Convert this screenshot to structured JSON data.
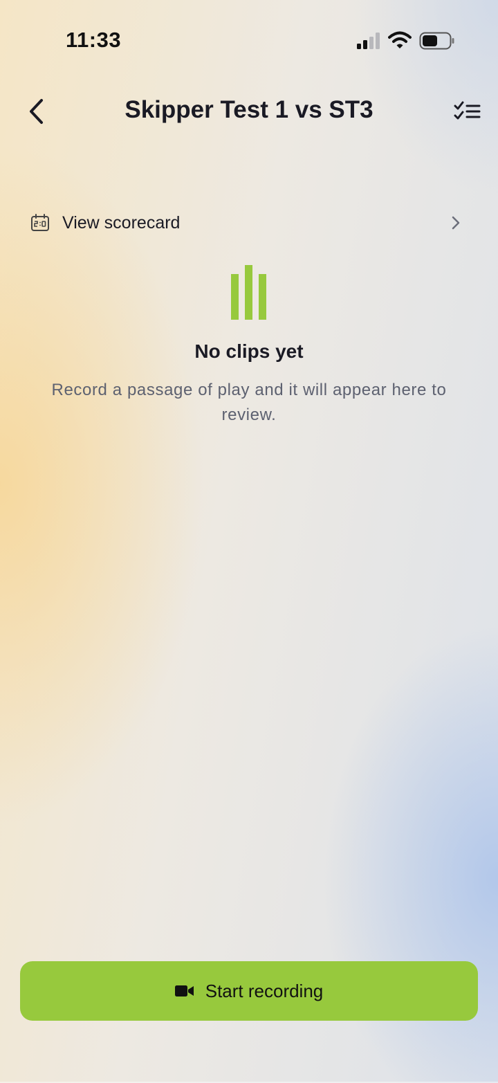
{
  "status_bar": {
    "time": "11:33",
    "signal_icon": "cellular-signal-icon",
    "wifi_icon": "wifi-icon",
    "battery_icon": "battery-icon"
  },
  "nav": {
    "back_icon": "chevron-left-icon",
    "title": "Skipper Test 1 vs ST3",
    "action_icon": "checklist-icon"
  },
  "scorecard": {
    "icon": "scoreboard-icon",
    "label": "View scorecard",
    "chevron_icon": "chevron-right-icon"
  },
  "empty_state": {
    "icon": "clips-bars-icon",
    "title": "No clips yet",
    "description": "Record a passage of play and it will appear here to review."
  },
  "record_button": {
    "icon": "video-camera-icon",
    "label": "Start recording"
  },
  "colors": {
    "accent": "#97c93d",
    "text_primary": "#1a1a24",
    "text_secondary": "#5d6170"
  }
}
